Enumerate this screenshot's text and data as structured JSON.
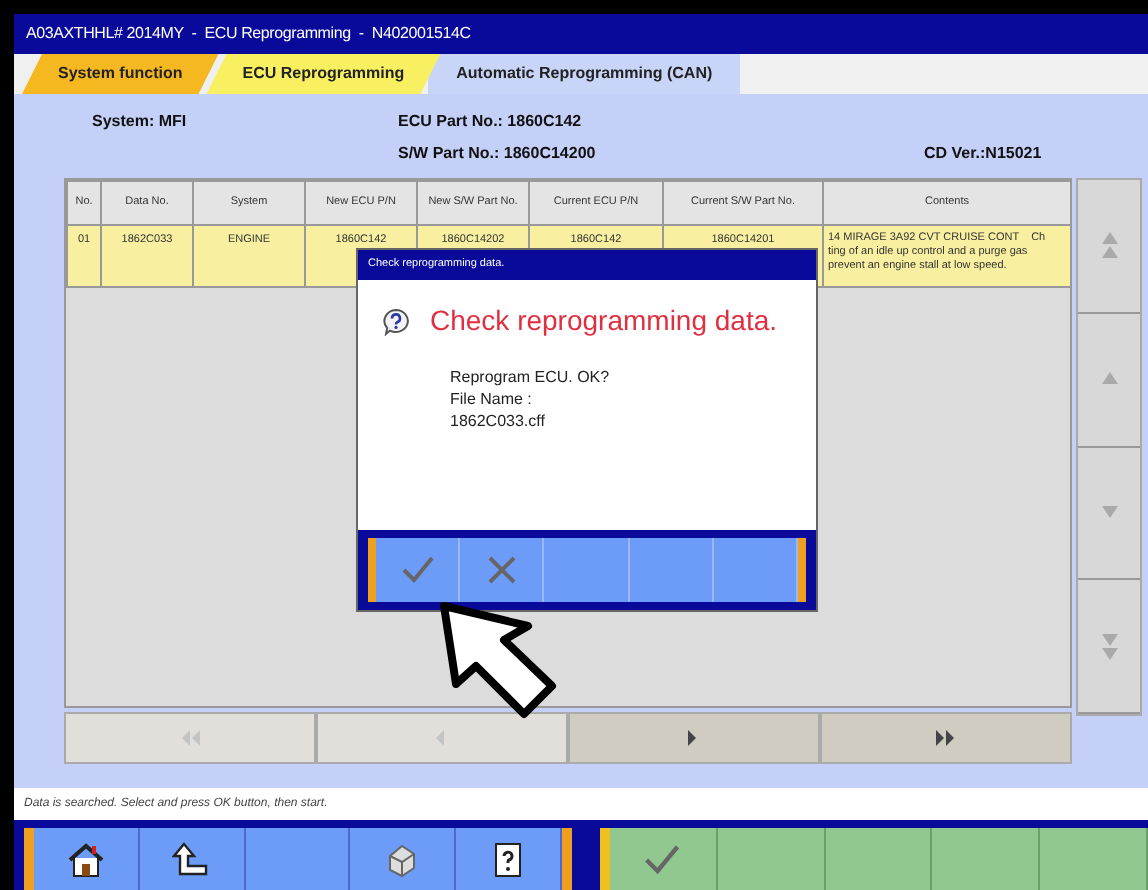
{
  "window": {
    "title": "A03AXTHHL# 2014MY  -  ECU Reprogramming  -  N402001514C"
  },
  "tabs": [
    {
      "label": "System function",
      "selected": false,
      "color": "#f5b820"
    },
    {
      "label": "ECU Reprogramming",
      "selected": false,
      "color": "#f8f060"
    },
    {
      "label": "Automatic Reprogramming (CAN)",
      "selected": true,
      "color": "#c8d4f8"
    }
  ],
  "info": {
    "system": "System: MFI",
    "ecu_part": "ECU Part No.: 1860C142",
    "sw_part": "S/W Part No.: 1860C14200",
    "cd_ver": "CD Ver.:N15021"
  },
  "table": {
    "columns": [
      "No.",
      "Data No.",
      "System",
      "New ECU P/N",
      "New S/W Part No.",
      "Current ECU P/N",
      "Current S/W Part No.",
      "Contents"
    ],
    "rows": [
      {
        "selected": true,
        "cells": [
          "01",
          "1862C033",
          "ENGINE",
          "1860C142",
          "1860C14202",
          "1860C142",
          "1860C14201"
        ],
        "contents": [
          "14 MIRAGE 3A92 CVT CRUISE CONT    Ch",
          "ting of an idle up control and a purge gas",
          "prevent an engine stall at low speed."
        ]
      }
    ]
  },
  "scroll_buttons": [
    {
      "kind": "first"
    },
    {
      "kind": "prev"
    },
    {
      "kind": "next"
    },
    {
      "kind": "last"
    }
  ],
  "page_buttons": [
    {
      "kind": "first",
      "disabled": true
    },
    {
      "kind": "prev",
      "disabled": true
    },
    {
      "kind": "next",
      "disabled": false
    },
    {
      "kind": "last",
      "disabled": false
    }
  ],
  "dialog": {
    "title": "Check reprogramming data.",
    "heading": "Check reprogramming data.",
    "lines": [
      "Reprogram ECU. OK?",
      "File Name :",
      "1862C033.cff"
    ],
    "buttons": [
      {
        "kind": "ok"
      },
      {
        "kind": "cancel"
      },
      {
        "kind": "empty"
      },
      {
        "kind": "empty"
      },
      {
        "kind": "empty"
      }
    ]
  },
  "status_bar": "Data is searched. Select and press OK button, then start.",
  "toolbar_left": [
    {
      "kind": "home"
    },
    {
      "kind": "back"
    },
    {
      "kind": "empty"
    },
    {
      "kind": "print"
    },
    {
      "kind": "help"
    }
  ],
  "toolbar_right": [
    {
      "kind": "ok"
    },
    {
      "kind": "empty"
    },
    {
      "kind": "empty"
    },
    {
      "kind": "empty"
    },
    {
      "kind": "empty"
    }
  ]
}
